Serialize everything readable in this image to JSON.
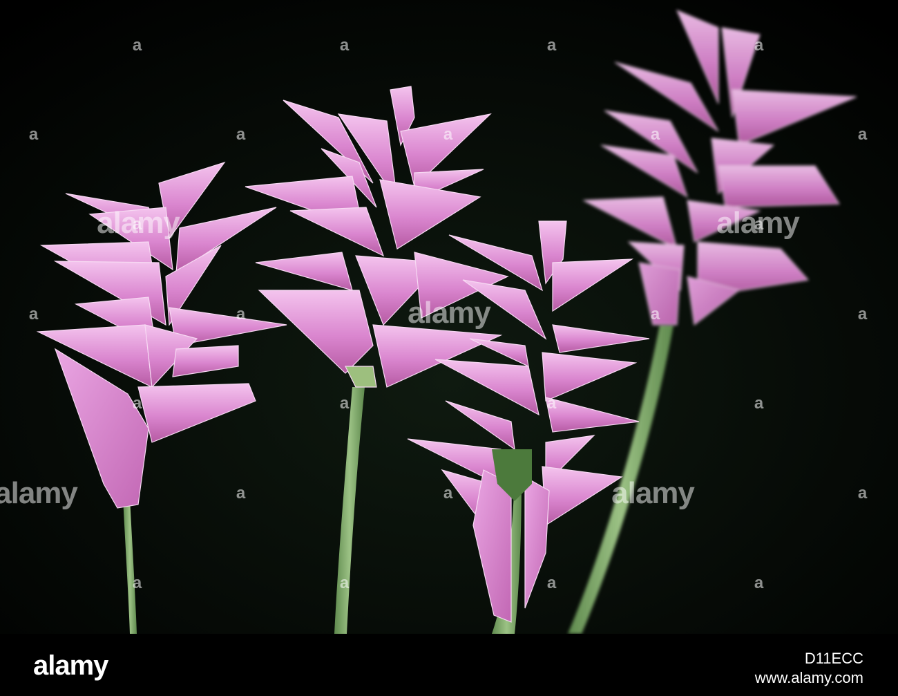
{
  "photo": {
    "description_colors": {
      "background": "#000000",
      "petal_light": "#f0b7ea",
      "petal_mid": "#d77fcb",
      "petal_dark": "#b3579f",
      "stem": "#7fa86b"
    }
  },
  "watermarks": {
    "small_text": "a",
    "large_text": "alamy"
  },
  "footer": {
    "logo": "alamy",
    "image_id": "D11ECC",
    "url": "www.alamy.com"
  }
}
